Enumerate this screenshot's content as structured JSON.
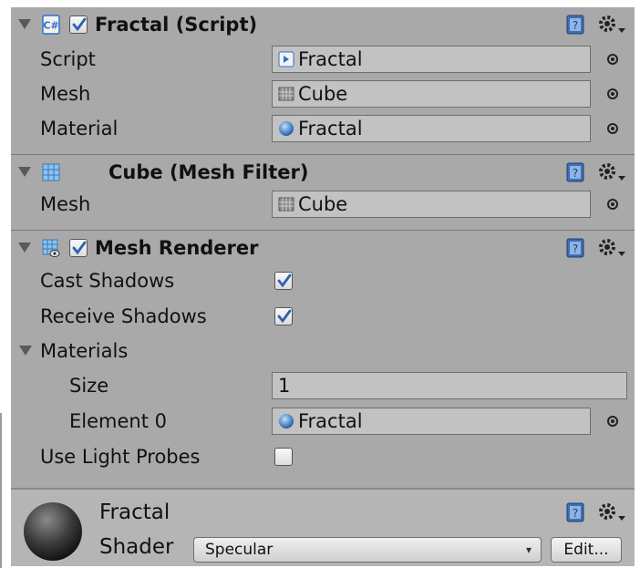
{
  "components": {
    "fractal_script": {
      "title": "Fractal (Script)",
      "enabled": true,
      "fields": [
        {
          "label": "Script",
          "value": "Fractal",
          "icon": "script-icon"
        },
        {
          "label": "Mesh",
          "value": "Cube",
          "icon": "mesh-icon"
        },
        {
          "label": "Material",
          "value": "Fractal",
          "icon": "material-icon"
        }
      ]
    },
    "mesh_filter": {
      "title": "Cube (Mesh Filter)",
      "fields": [
        {
          "label": "Mesh",
          "value": "Cube",
          "icon": "mesh-icon"
        }
      ]
    },
    "mesh_renderer": {
      "title": "Mesh Renderer",
      "enabled": true,
      "cast_shadows": {
        "label": "Cast Shadows",
        "checked": true
      },
      "receive_shadows": {
        "label": "Receive Shadows",
        "checked": true
      },
      "materials": {
        "label": "Materials",
        "size_label": "Size",
        "size_value": "1",
        "element_label": "Element 0",
        "element_value": "Fractal"
      },
      "use_light_probes": {
        "label": "Use Light Probes",
        "checked": false
      }
    }
  },
  "material_panel": {
    "name": "Fractal",
    "shader_label": "Shader",
    "shader_value": "Specular",
    "edit_label": "Edit..."
  },
  "colors": {
    "panel_bg": "#a9a9a9",
    "field_bg": "#c2c2c2",
    "check_blue": "#2f5fae"
  }
}
